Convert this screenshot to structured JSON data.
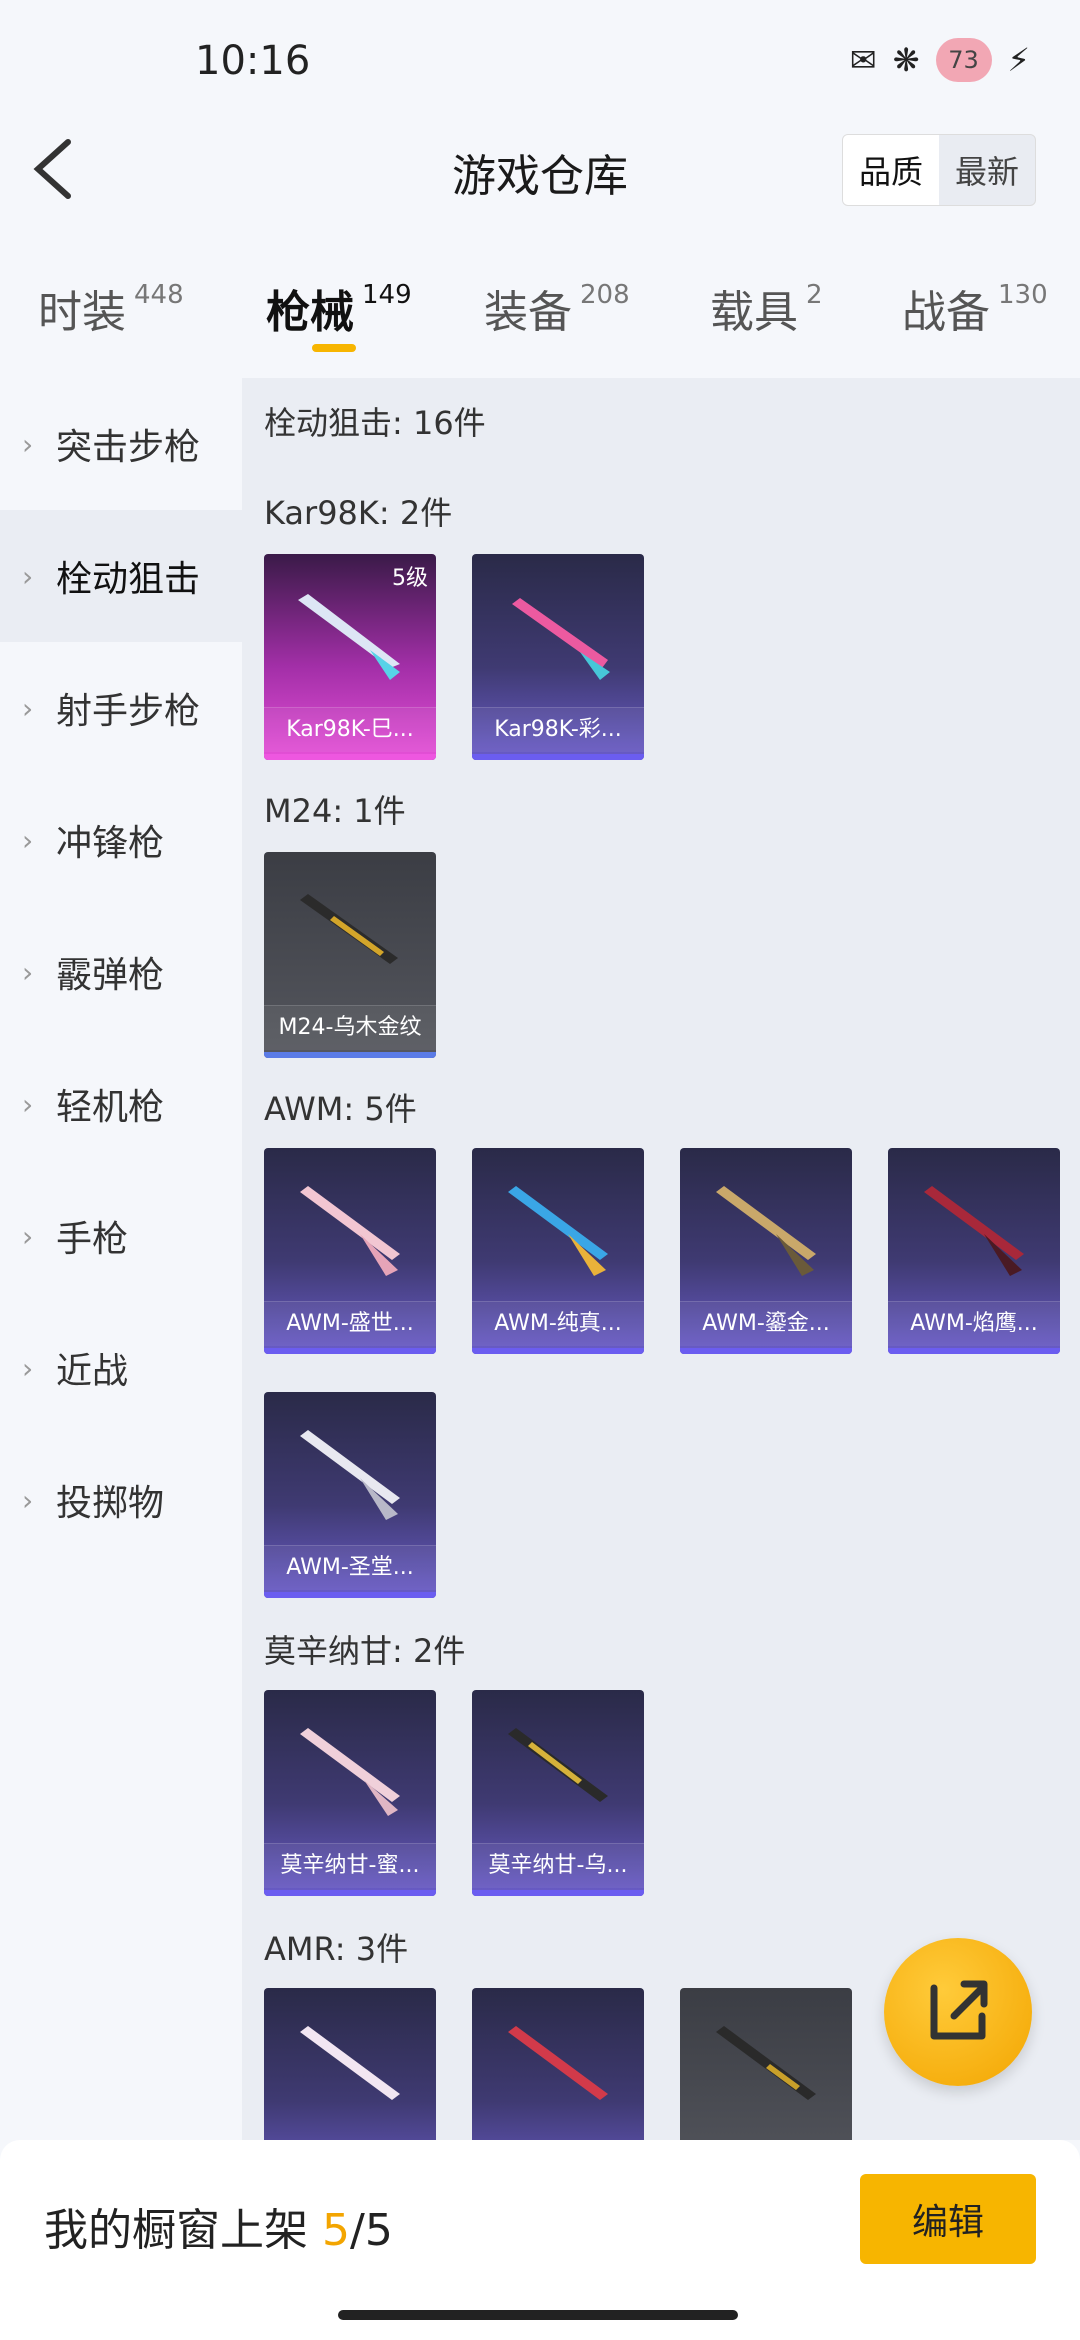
{
  "status": {
    "time": "10:16",
    "battery": "73"
  },
  "header": {
    "title": "游戏仓库",
    "sort": [
      "品质",
      "最新"
    ]
  },
  "tabs": [
    {
      "label": "时装",
      "count": "448"
    },
    {
      "label": "枪械",
      "count": "149"
    },
    {
      "label": "装备",
      "count": "208"
    },
    {
      "label": "载具",
      "count": "2"
    },
    {
      "label": "战备",
      "count": "130"
    }
  ],
  "categories": [
    "突击步枪",
    "栓动狙击",
    "射手步枪",
    "冲锋枪",
    "霰弹枪",
    "轻机枪",
    "手枪",
    "近战",
    "投掷物"
  ],
  "content": {
    "total": "栓动狙击: 16件",
    "groups": [
      {
        "title": "Kar98K: 2件",
        "items": [
          {
            "name": "Kar98K-巳...",
            "level": "5级"
          },
          {
            "name": "Kar98K-彩..."
          }
        ]
      },
      {
        "title": "M24: 1件",
        "items": [
          {
            "name": "M24-乌木金纹"
          }
        ]
      },
      {
        "title": "AWM: 5件",
        "items": [
          {
            "name": "AWM-盛世..."
          },
          {
            "name": "AWM-纯真..."
          },
          {
            "name": "AWM-鎏金..."
          },
          {
            "name": "AWM-焰鹰..."
          },
          {
            "name": "AWM-圣堂..."
          }
        ]
      },
      {
        "title": "莫辛纳甘: 2件",
        "items": [
          {
            "name": "莫辛纳甘-蜜..."
          },
          {
            "name": "莫辛纳甘-乌..."
          }
        ]
      },
      {
        "title": "AMR: 3件",
        "items": [
          {
            "name": ""
          },
          {
            "name": ""
          },
          {
            "name": ""
          }
        ]
      }
    ]
  },
  "bottom": {
    "label": "我的橱窗上架 ",
    "current": "5",
    "total": "/5",
    "edit": "编辑"
  },
  "colors": {
    "accent": "#f7b500"
  }
}
